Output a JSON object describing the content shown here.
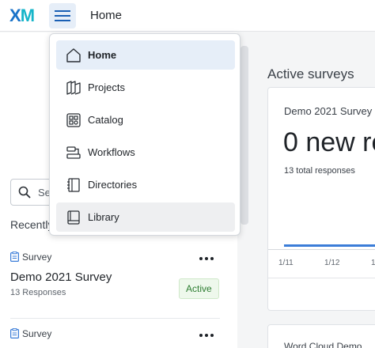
{
  "header": {
    "logo": {
      "x": "X",
      "m": "M"
    },
    "title": "Home"
  },
  "nav_menu": {
    "items": [
      {
        "label": "Home",
        "icon": "home-icon",
        "active": true
      },
      {
        "label": "Projects",
        "icon": "projects-icon"
      },
      {
        "label": "Catalog",
        "icon": "catalog-icon"
      },
      {
        "label": "Workflows",
        "icon": "workflows-icon"
      },
      {
        "label": "Directories",
        "icon": "directories-icon"
      },
      {
        "label": "Library",
        "icon": "library-icon",
        "hovered": true
      }
    ]
  },
  "left": {
    "search_text": "Se",
    "recently_label": "Recently",
    "cards": [
      {
        "type": "Survey",
        "name": "Demo 2021 Survey",
        "responses": "13 Responses",
        "status": "Active"
      },
      {
        "type": "Survey"
      }
    ]
  },
  "right": {
    "section_title": "Active surveys",
    "survey_card": {
      "title": "Demo 2021 Survey",
      "big": "0 new re",
      "total": "13 total responses",
      "ticks": [
        "1/11",
        "1/12",
        "1/"
      ]
    },
    "word_cloud_title": "Word Cloud Demo"
  },
  "colors": {
    "logo_x": "#1a73c9",
    "logo_m": "#16b5c9",
    "accent": "#3b7dd8",
    "active_nav_bg": "#e6eef8",
    "status_green": "#2e7d32"
  }
}
